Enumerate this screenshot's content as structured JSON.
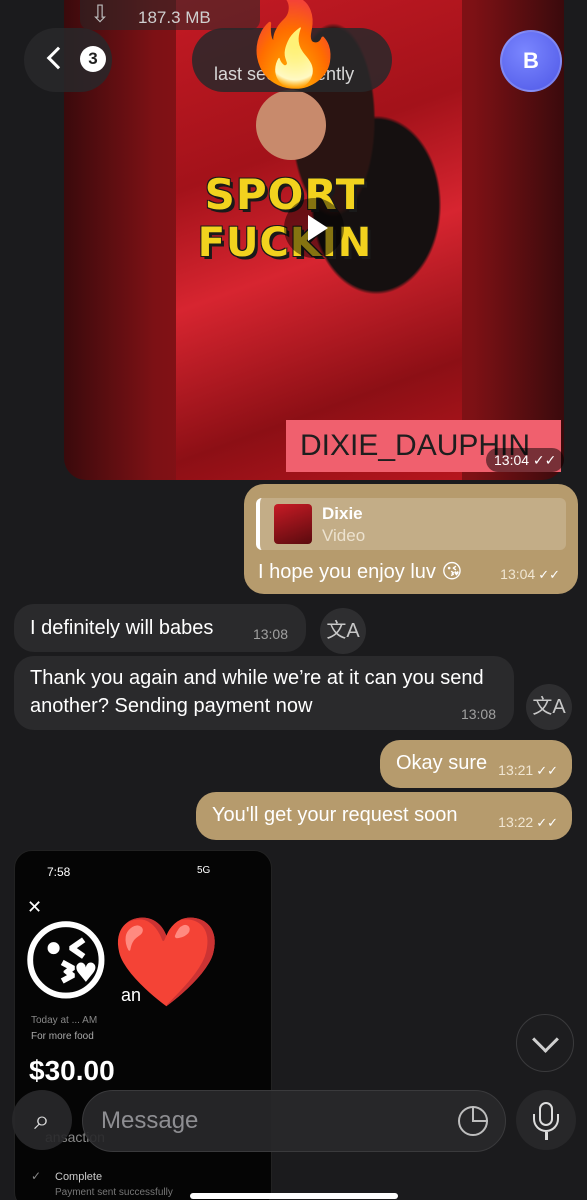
{
  "header": {
    "back_count": "3",
    "status_text": "last seen recently",
    "avatar_letter": "B",
    "fire_emoji": "🔥"
  },
  "video": {
    "download_size": "187.3 MB",
    "download_icon": "cloud-download-icon",
    "title_line1": "SPORT",
    "title_line2": "FUCKIN",
    "watermark": "DIXIE_DAUPHIN",
    "time": "13:04 ✓✓"
  },
  "messages": [
    {
      "direction": "out",
      "reply_name": "Dixie",
      "reply_type": "Video",
      "text": "I hope you enjoy luv 😘",
      "time": "13:04"
    },
    {
      "direction": "in",
      "text": "I definitely will babes",
      "time": "13:08"
    },
    {
      "direction": "in",
      "text": "Thank you again and while we’re  at it can you send another? Sending payment now",
      "time": "13:08"
    },
    {
      "direction": "out",
      "text": "Okay sure",
      "time": "13:21"
    },
    {
      "direction": "out",
      "text": "You'll get your request soon",
      "time": "13:22"
    }
  ],
  "ticks": "✓✓",
  "translate_icon": "文A",
  "screenshot": {
    "time": "7:58",
    "signal": "5G",
    "close": "✕",
    "name_fragment": "an",
    "date": "Today at ... AM",
    "note": "For more food",
    "amount": "$30.00",
    "transaction_label": "ansaction",
    "status_check": "✓",
    "status": "Complete",
    "status_detail": "Payment sent successfully",
    "overlay_emoji": "😘❤️"
  },
  "composer": {
    "placeholder": "Message",
    "attach_icon": "paperclip-icon"
  },
  "colors": {
    "outgoing_bubble": "#b69b6d",
    "incoming_bubble": "#2a2a2c",
    "background": "#1b1b1d",
    "avatar": "#5b65f0"
  }
}
